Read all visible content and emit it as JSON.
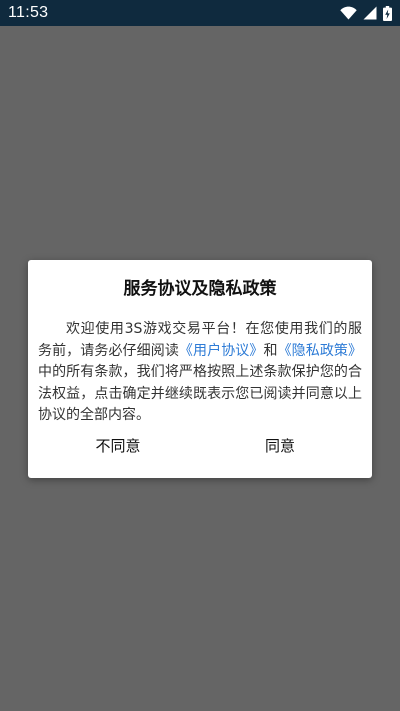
{
  "status_bar": {
    "time": "11:53",
    "icons": [
      "wifi-icon",
      "signal-icon",
      "battery-charging-icon"
    ]
  },
  "dialog": {
    "title": "服务协议及隐私政策",
    "body": {
      "part1": "欢迎使用3S游戏交易平台！在您使用我们的服务前，请务必仔细阅读",
      "link_user_agreement": "《用户协议》",
      "part2": "和",
      "link_privacy_policy": "《隐私政策》",
      "part3": "中的所有条款，我们将严格按照上述条款保护您的合法权益，点击确定并继续既表示您已阅读并同意以上协议的全部内容。"
    },
    "buttons": {
      "decline": "不同意",
      "agree": "同意"
    }
  },
  "colors": {
    "status_bar": "#0f2a3e",
    "overlay": "#656565",
    "link": "#2d7bd6"
  }
}
